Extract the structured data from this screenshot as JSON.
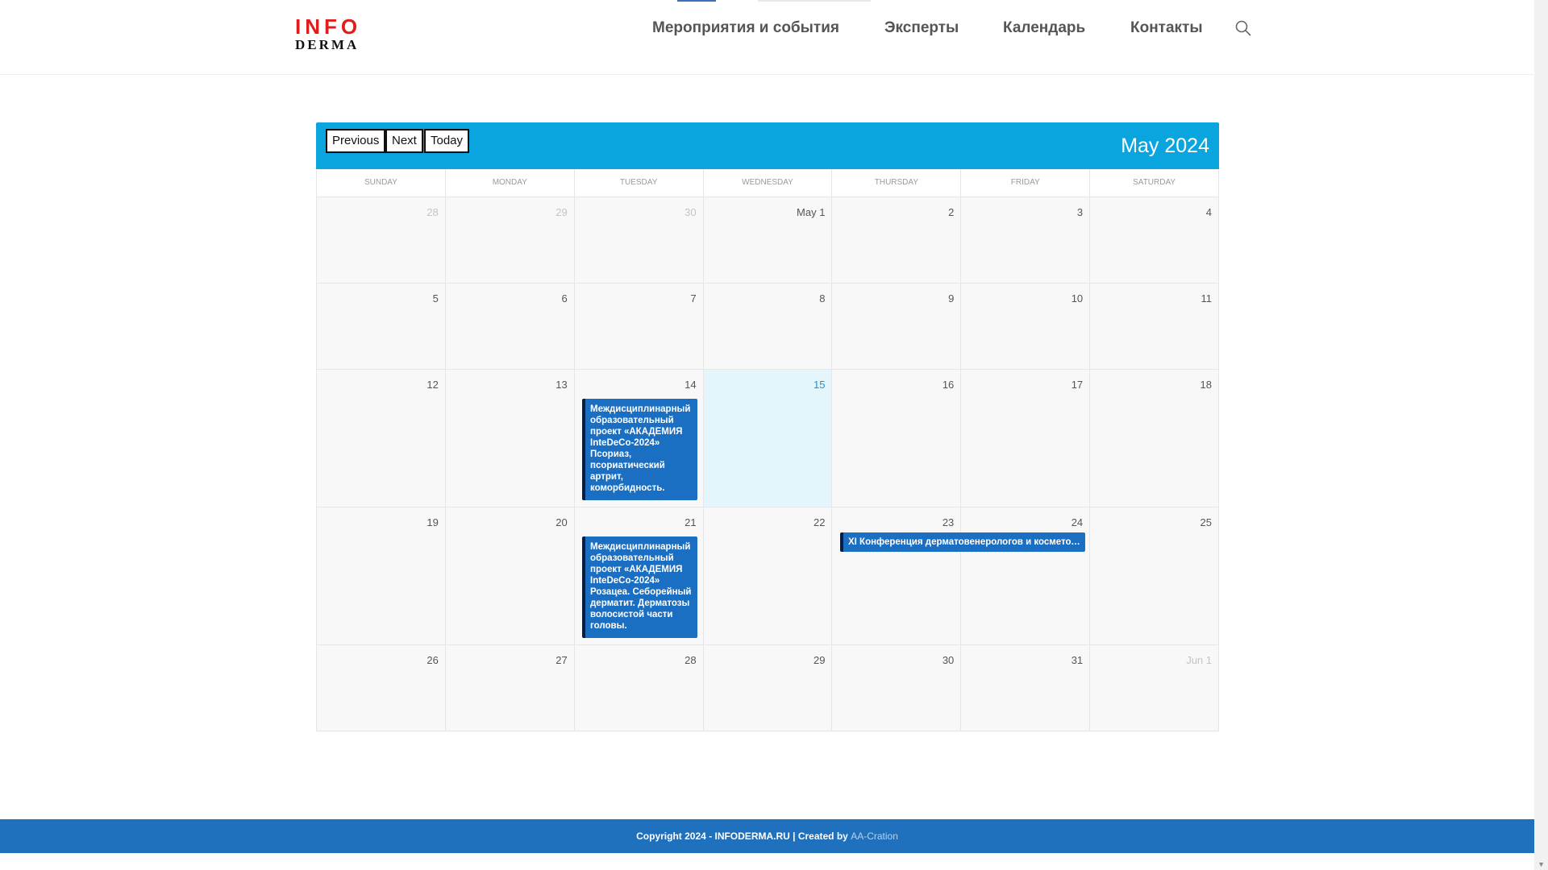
{
  "logo": {
    "top": "INFO",
    "bottom": "DERMA"
  },
  "nav": {
    "items": [
      {
        "label": "Мероприятия и события"
      },
      {
        "label": "Эксперты"
      },
      {
        "label": "Календарь"
      },
      {
        "label": "Контакты"
      }
    ],
    "search_icon": "search-icon"
  },
  "calendar": {
    "buttons": {
      "previous": "Previous",
      "next": "Next",
      "today": "Today"
    },
    "title": "May 2024",
    "weekdays": [
      "SUNDAY",
      "MONDAY",
      "TUESDAY",
      "WEDNESDAY",
      "THURSDAY",
      "FRIDAY",
      "SATURDAY"
    ],
    "today_date": "15",
    "weeks": [
      [
        {
          "label": "28",
          "other": true
        },
        {
          "label": "29",
          "other": true
        },
        {
          "label": "30",
          "other": true
        },
        {
          "label": "May 1"
        },
        {
          "label": "2"
        },
        {
          "label": "3"
        },
        {
          "label": "4"
        }
      ],
      [
        {
          "label": "5"
        },
        {
          "label": "6"
        },
        {
          "label": "7"
        },
        {
          "label": "8"
        },
        {
          "label": "9"
        },
        {
          "label": "10"
        },
        {
          "label": "11"
        }
      ],
      [
        {
          "label": "12"
        },
        {
          "label": "13"
        },
        {
          "label": "14"
        },
        {
          "label": "15",
          "today": true
        },
        {
          "label": "16"
        },
        {
          "label": "17"
        },
        {
          "label": "18"
        }
      ],
      [
        {
          "label": "19"
        },
        {
          "label": "20"
        },
        {
          "label": "21"
        },
        {
          "label": "22"
        },
        {
          "label": "23"
        },
        {
          "label": "24"
        },
        {
          "label": "25"
        }
      ],
      [
        {
          "label": "26"
        },
        {
          "label": "27"
        },
        {
          "label": "28"
        },
        {
          "label": "29"
        },
        {
          "label": "30"
        },
        {
          "label": "31"
        },
        {
          "label": "Jun 1",
          "other": true
        }
      ]
    ],
    "events": [
      {
        "title": "Междисциплинарный образовательный проект «АКАДЕМИЯ InteDeCo-2024» Псориаз, псориатический артрит, коморбидность.",
        "date": "14"
      },
      {
        "title": "Междисциплинарный образовательный проект «АКАДЕМИЯ InteDeCo-2024» Розацеа. Себорейный дерматит. Дерматозы волосистой части головы.",
        "date": "21"
      },
      {
        "title": "XI Конференция дерматовенерологов и косметологов",
        "date": "23–24"
      }
    ],
    "colors": {
      "toolbar": "#0aa5de",
      "event": "#1b6fc2",
      "today_bg": "#e5f5fc"
    }
  },
  "footer": {
    "text": "Copyright 2024 - INFODERMA.RU | Created by ",
    "link": "AA-Cration"
  }
}
